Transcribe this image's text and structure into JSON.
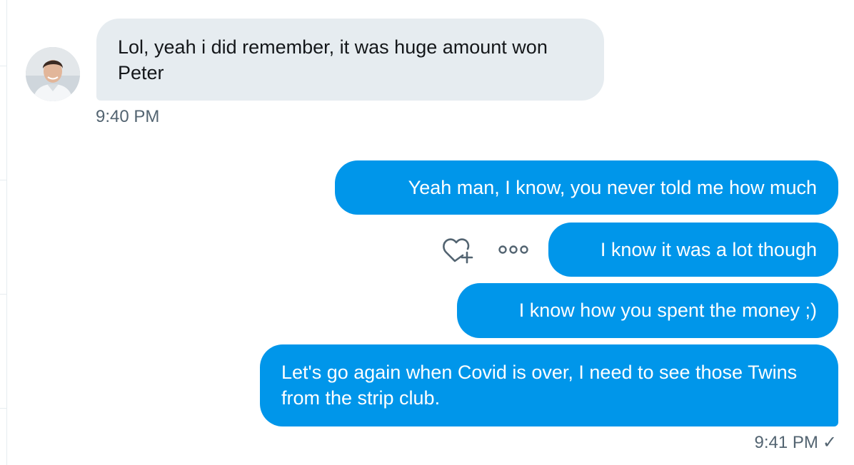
{
  "messages": [
    {
      "direction": "incoming",
      "text": "Lol, yeah i did remember, it was huge amount won Peter"
    },
    {
      "direction": "outgoing",
      "text": "Yeah man, I know, you never told me how much"
    },
    {
      "direction": "outgoing",
      "text": "I know it was a lot though"
    },
    {
      "direction": "outgoing",
      "text": "I know how you spent the money ;)"
    },
    {
      "direction": "outgoing",
      "text": "Let's go again when Covid is over, I need to see those Twins from the strip club."
    }
  ],
  "timestamps": {
    "incoming": "9:40 PM",
    "outgoing": "9:41 PM",
    "outgoing_status": "✓"
  },
  "icons": {
    "react": "heart-plus-icon",
    "more": "more-dots-icon"
  },
  "colors": {
    "outgoing_bubble": "#0096ea",
    "incoming_bubble": "#e6ecf0",
    "timestamp": "#536471"
  }
}
